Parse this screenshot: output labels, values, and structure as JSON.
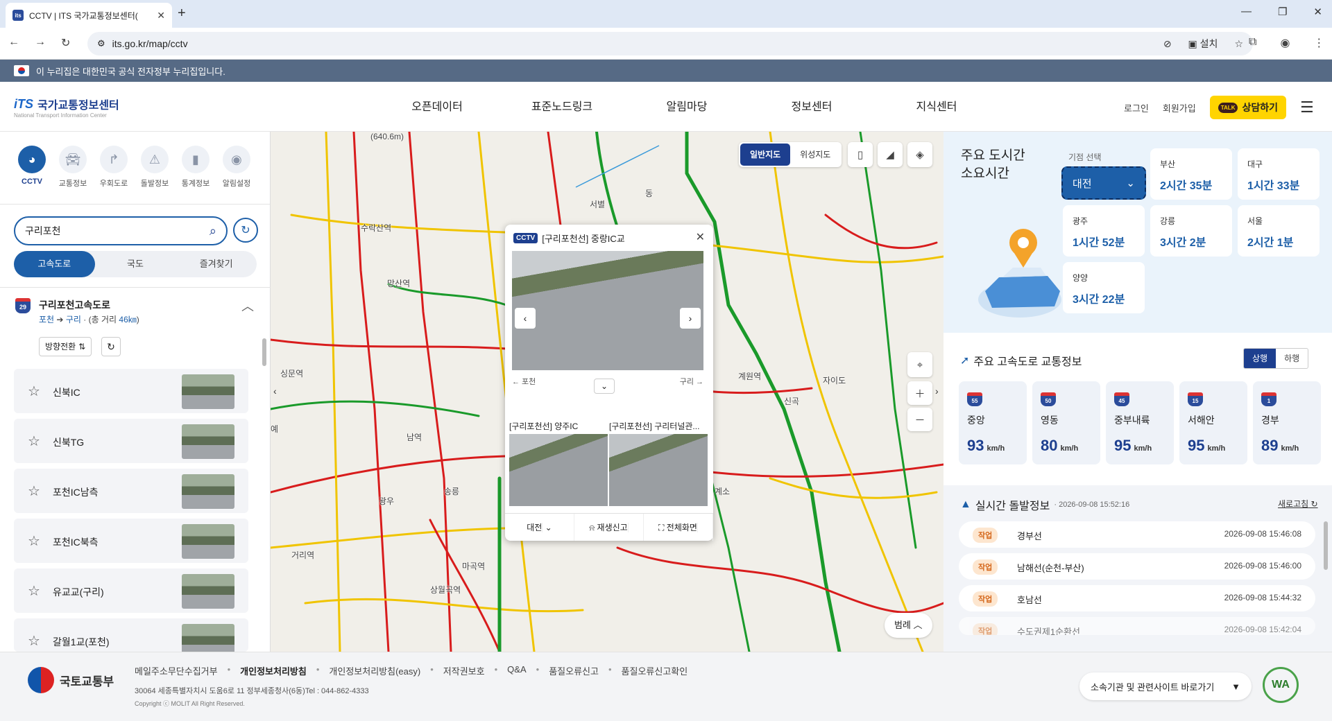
{
  "browser": {
    "tab_title": "CCTV | ITS 국가교통정보센터(",
    "url": "its.go.kr/map/cctv",
    "install_label": "설치"
  },
  "gov_banner": "이 누리집은 대한민국 공식 전자정부 누리집입니다.",
  "header": {
    "logo_text": "국가교통정보센터",
    "logo_mark": "iTS",
    "logo_sub": "National Transport Information Center",
    "nav": [
      "오픈데이터",
      "표준노드링크",
      "알림마당",
      "정보센터",
      "지식센터"
    ],
    "login": "로그인",
    "signup": "회원가입",
    "talk_button": "상담하기",
    "talk_badge": "TALK"
  },
  "left": {
    "categories": [
      {
        "label": "CCTV",
        "icon": "cctv-icon"
      },
      {
        "label": "교통정보",
        "icon": "car-icon"
      },
      {
        "label": "우회도로",
        "icon": "detour-icon"
      },
      {
        "label": "돌발정보",
        "icon": "incident-icon"
      },
      {
        "label": "통계정보",
        "icon": "chart-icon"
      },
      {
        "label": "알림설정",
        "icon": "bell-icon"
      }
    ],
    "search_value": "구리포천",
    "tabs": [
      "고속도로",
      "국도",
      "즐겨찾기"
    ],
    "road": {
      "shield": "29",
      "name": "구리포천고속도로",
      "from": "포천",
      "to": "구리",
      "distance_prefix": "(총 거리",
      "distance": "46㎞",
      "distance_suffix": ")"
    },
    "direction_button": "방향전환",
    "cameras": [
      "신북IC",
      "신북TG",
      "포천IC남측",
      "포천IC북측",
      "유교교(구리)",
      "갈월1교(포천)"
    ]
  },
  "map": {
    "types": [
      "일반지도",
      "위성지도"
    ],
    "legend": "범례",
    "labels": [
      "(640.6m)",
      "수락산역",
      "서별",
      "망산역",
      "동",
      "계원역",
      "신곡",
      "광우",
      "송릉",
      "마곡역",
      "상월곡역",
      "싱문역",
      "거리역",
      "남역",
      "예",
      "계소",
      "자이도"
    ],
    "popup": {
      "tag": "CCTV",
      "title": "[구리포천선] 중랑IC교",
      "from": "← 포천",
      "to": "구리 →",
      "sub1": "[구리포천선] 양주IC",
      "sub2": "[구리포천선] 구리터널관...",
      "region": "대전",
      "report": "재생신고",
      "fullscreen": "전체화면"
    }
  },
  "right": {
    "city_title_1": "주요 도시간",
    "city_title_2": "소요시간",
    "origin_label": "기점 선택",
    "origin": "대전",
    "cities": [
      {
        "name": "부산",
        "time": "2시간 35분"
      },
      {
        "name": "대구",
        "time": "1시간 33분"
      },
      {
        "name": "광주",
        "time": "1시간 52분"
      },
      {
        "name": "강릉",
        "time": "3시간 2분"
      },
      {
        "name": "서울",
        "time": "2시간 1분"
      },
      {
        "name": "양양",
        "time": "3시간 22분"
      }
    ],
    "hw_title": "주요 고속도로 교통정보",
    "hw_tabs": [
      "상행",
      "하행"
    ],
    "highways": [
      {
        "no": "55",
        "name": "중앙",
        "speed": "93"
      },
      {
        "no": "50",
        "name": "영동",
        "speed": "80"
      },
      {
        "no": "45",
        "name": "중부내륙",
        "speed": "95"
      },
      {
        "no": "15",
        "name": "서해안",
        "speed": "95"
      },
      {
        "no": "1",
        "name": "경부",
        "speed": "89"
      }
    ],
    "speed_unit": "km/h",
    "inc_title": "실시간 돌발정보",
    "inc_time": "2026-09-08 15:52:16",
    "inc_refresh": "새로고침",
    "incidents": [
      {
        "tag": "작업",
        "road": "경부선",
        "time": "2026-09-08 15:46:08"
      },
      {
        "tag": "작업",
        "road": "남해선(순천-부산)",
        "time": "2026-09-08 15:46:00"
      },
      {
        "tag": "작업",
        "road": "호남선",
        "time": "2026-09-08 15:44:32"
      },
      {
        "tag": "작업",
        "road": "수도권제1순환선",
        "time": "2026-09-08 15:42:04"
      }
    ]
  },
  "footer": {
    "ministry": "국토교통부",
    "links": [
      "메일주소무단수집거부",
      "개인정보처리방침",
      "개인정보처리방침(easy)",
      "저작권보호",
      "Q&A",
      "품질오류신고",
      "품질오류신고확인"
    ],
    "address": "30064 세종특별자치시 도움6로 11 정부세종청사(6동)Tel : 044-862-4333",
    "copyright": "Copyright ⓒ MOLIT All Right Reserved.",
    "sites": "소속기관 및 관련사이트 바로가기",
    "wa": "WA"
  },
  "colors": {
    "primary": "#1d3f8f",
    "accent": "#1d5fa8",
    "road_green": "#1a9a2a",
    "road_yellow": "#f0c400",
    "road_red": "#d81c1c"
  }
}
